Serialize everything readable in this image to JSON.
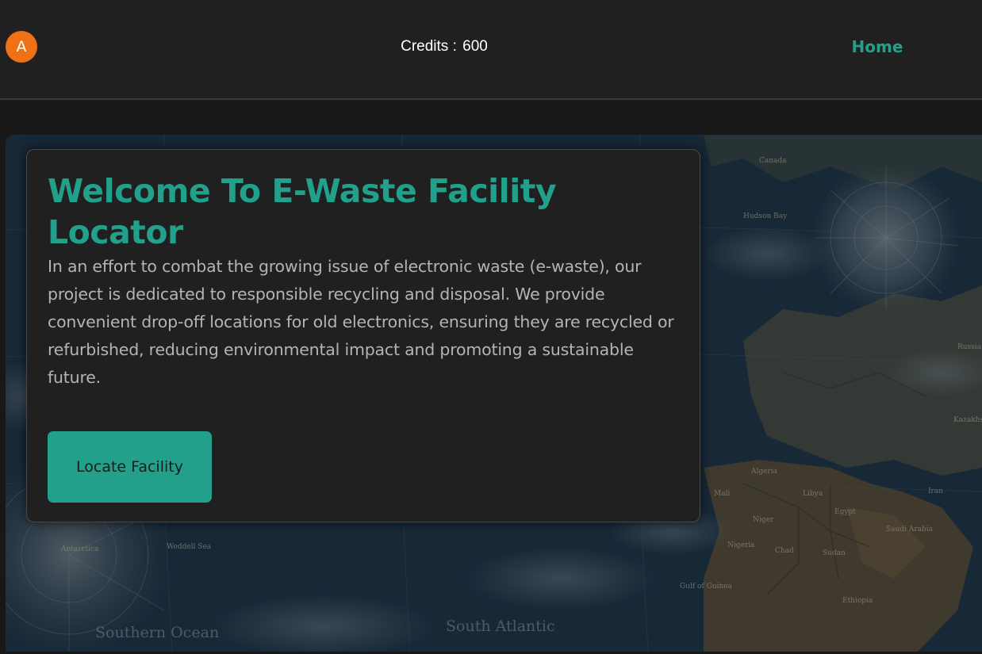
{
  "header": {
    "avatar_letter": "A",
    "credits_label": "Credits :",
    "credits_value": "600",
    "nav": {
      "home_label": "Home"
    }
  },
  "hero": {
    "map_labels": {
      "canada": "Canada",
      "hudson_bay": "Hudson Bay",
      "russia": "Russia",
      "kazakhstan": "Kazakhst",
      "algeria": "Algeria",
      "libya": "Libya",
      "egypt": "Egypt",
      "iran": "Iran",
      "mali": "Mali",
      "niger": "Niger",
      "nigeria": "Nigeria",
      "chad": "Chad",
      "sudan": "Sudan",
      "saudi_arabia": "Saudi Arabia",
      "ethiopia": "Ethiopia",
      "gulf_of_guinea": "Gulf of Guinea",
      "antarctica": "Antarctica",
      "weddell_sea": "Weddell Sea",
      "southern_ocean": "Southern Ocean",
      "south_atlantic": "South Atlantic"
    },
    "card": {
      "title": "Welcome To E-Waste Facility Locator",
      "description": "In an effort to combat the growing issue of electronic waste (e-waste), our project is dedicated to responsible recycling and disposal. We provide convenient drop-off locations for old electronics, ensuring they are recycled or refurbished, reducing environmental impact and promoting a sustainable future.",
      "button_label": "Locate Facility"
    }
  },
  "colors": {
    "accent": "#23a08b",
    "avatar": "#f07015",
    "header_bg": "#202020",
    "card_bg": "#202020",
    "ocean": "#1c3143"
  }
}
